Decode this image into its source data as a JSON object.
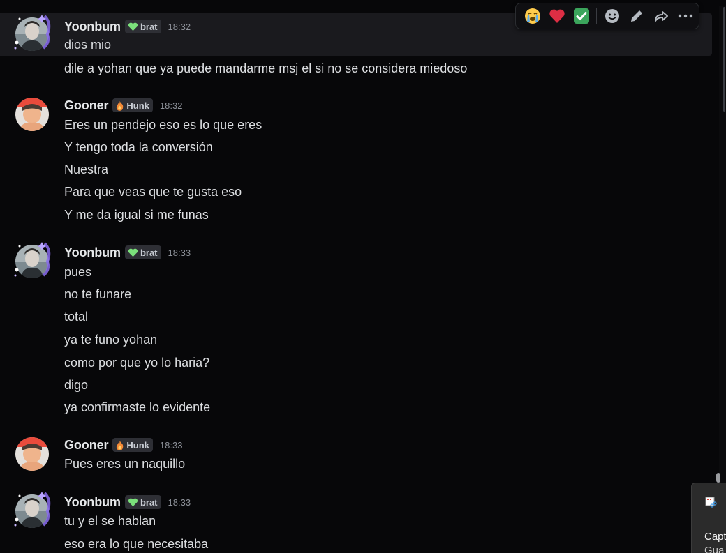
{
  "toolbar": {
    "reactions": [
      {
        "name": "loudly-crying-face",
        "glyph": "😭"
      },
      {
        "name": "red-heart",
        "glyph": "❤"
      },
      {
        "name": "check-mark",
        "glyph": "✔"
      }
    ],
    "actions": [
      "add-reaction-icon",
      "edit-icon",
      "forward-icon",
      "more-icon"
    ]
  },
  "colors": {
    "background": "#070709",
    "hover": "#1a1a1e",
    "username": "#e6e8ea",
    "timestamp": "#8e929a",
    "tag_bg": "#2e2f35"
  },
  "messages": [
    {
      "author": "Yoonbum",
      "tag": "brat",
      "tag_icon": "green-heart-icon",
      "time": "18:32",
      "lines": [
        "dios mio",
        "dile a yohan que ya puede mandarme msj el si no se considera miedoso"
      ]
    },
    {
      "author": "Gooner",
      "tag": "Hunk",
      "tag_icon": "flame-icon",
      "time": "18:32",
      "lines": [
        "Eres un pendejo eso es lo que eres",
        "Y tengo toda la conversión",
        "Nuestra",
        "Para que veas que te gusta eso",
        "Y me da igual si me funas"
      ]
    },
    {
      "author": "Yoonbum",
      "tag": "brat",
      "tag_icon": "green-heart-icon",
      "time": "18:33",
      "lines": [
        "pues",
        "no te funare",
        "total",
        "ya te funo yohan",
        "como por que yo lo haria?",
        "digo",
        "ya confirmaste lo evidente"
      ]
    },
    {
      "author": "Gooner",
      "tag": "Hunk",
      "tag_icon": "flame-icon",
      "time": "18:33",
      "lines": [
        "Pues eres un naquillo"
      ]
    },
    {
      "author": "Yoonbum",
      "tag": "brat",
      "tag_icon": "green-heart-icon",
      "time": "18:33",
      "lines": [
        "tu y el se hablan",
        "eso era lo que necesitaba"
      ]
    }
  ],
  "notification": {
    "line1": "Capt",
    "line2": "Gua"
  }
}
